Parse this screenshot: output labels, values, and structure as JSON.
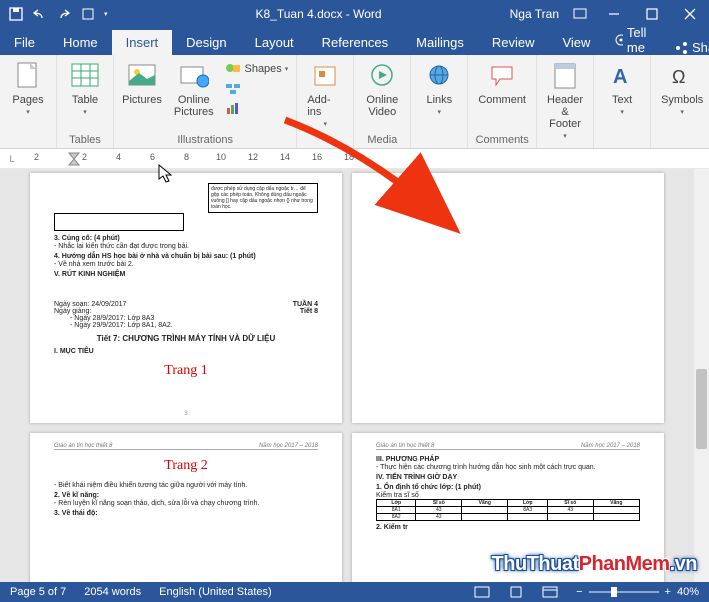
{
  "titlebar": {
    "document": "K8_Tuan 4.docx - Word",
    "user": "Nga Tran"
  },
  "tabs": {
    "items": [
      "File",
      "Home",
      "Insert",
      "Design",
      "Layout",
      "References",
      "Mailings",
      "Review",
      "View"
    ],
    "active_index": 2,
    "tell_me": "Tell me",
    "share": "Share"
  },
  "ribbon": {
    "pages": {
      "label": "Pages",
      "btn": "Pages"
    },
    "tables": {
      "label": "Tables",
      "btn": "Table"
    },
    "illustrations": {
      "label": "Illustrations",
      "pictures": "Pictures",
      "online_pictures": "Online Pictures",
      "shapes": "Shapes",
      "smartart": "",
      "chart": "",
      "screenshot": ""
    },
    "addins": {
      "label": "",
      "btn": "Add-ins"
    },
    "media": {
      "label": "Media",
      "btn": "Online Video"
    },
    "links": {
      "label": "",
      "btn": "Links"
    },
    "comments": {
      "label": "Comments",
      "btn": "Comment"
    },
    "headerfooter": {
      "label": "",
      "btn": "Header & Footer"
    },
    "text": {
      "label": "",
      "btn": "Text"
    },
    "symbols": {
      "label": "",
      "btn": "Symbols"
    }
  },
  "ruler": {
    "marks": [
      "2",
      "",
      "2",
      "4",
      "6",
      "8",
      "10",
      "12",
      "14",
      "16",
      "18"
    ]
  },
  "doc": {
    "page1": {
      "box_text": "được phép sử dụng cặp dấu ngoặc tr… để gộp các phép toán. Không dùng dấu ngoặc vuông [] hay cặp dấu ngoặc nhọn {} như trong toán học.",
      "h_cungco": "3. Củng cố: (4 phút)",
      "cungco_line": "- Nhắc lại kiến thức cần đạt được trong bài.",
      "h_huongdan": "4. Hướng dẫn HS học bài ở nhà và chuẩn bị bài sau: (1 phút)",
      "huongdan_line": "- Về nhà xem trước bài 2.",
      "h_rut": "V. RÚT KINH NGHIỆM",
      "ngay_soan": "Ngày soạn: 24/09/2017",
      "tuan": "TUẦN 4",
      "ngay_giang": "Ngày giảng:",
      "tiet": "Tiết 8",
      "g1": "- Ngày 28/9/2017: Lớp 8A3",
      "g2": "- Ngày 29/9/2017: Lớp 8A1, 8A2.",
      "title": "Tiết 7: CHƯƠNG TRÌNH MÁY TÍNH VÀ DỮ LIỆU",
      "muctieu": "I. MỤC TIÊU",
      "red": "Trang 1",
      "num": "3"
    },
    "page2": {
      "hdr_left": "Giáo án tin học thiết 8",
      "hdr_right": "Năm học 2017 – 2018",
      "red": "Trang 2",
      "h1": "2. Về kĩ năng:",
      "l1": "- Biết khái niệm điều khiển tương tác giữa người với máy tính.",
      "l2": "- Rèn luyện kĩ năng soạn thảo, dịch, sửa lỗi và chạy chương trình.",
      "h2": "3. Về thái độ:"
    },
    "page3": {
      "hdr_left": "Giáo án tin học thiết 8",
      "hdr_right": "Năm học 2017 – 2018",
      "h1": "III. PHƯƠNG PHÁP",
      "l1": "- Thực hiện các chương trình hướng dẫn học sinh một cách trực quan.",
      "h2": "IV. TIẾN TRÌNH GIỜ DẠY",
      "h3": "1. Ổn định tổ chức lớp: (1 phút)",
      "l3": "Kiểm tra sĩ số",
      "tbl": {
        "headers": [
          "Lớp",
          "Sĩ số",
          "Vắng",
          "Lớp",
          "Sĩ số",
          "Vắng"
        ],
        "r1": [
          "8A1",
          "43",
          "",
          "8A3",
          "43",
          ""
        ],
        "r2": [
          "8A2",
          "43",
          "",
          "",
          "",
          ""
        ]
      },
      "h4": "2. Kiểm tr"
    }
  },
  "status": {
    "page": "Page 5 of 7",
    "words": "2054 words",
    "lang": "English (United States)",
    "zoom": "40%"
  },
  "watermark": {
    "a": "ThuThuat",
    "b": "PhanMem",
    "c": ".vn"
  }
}
